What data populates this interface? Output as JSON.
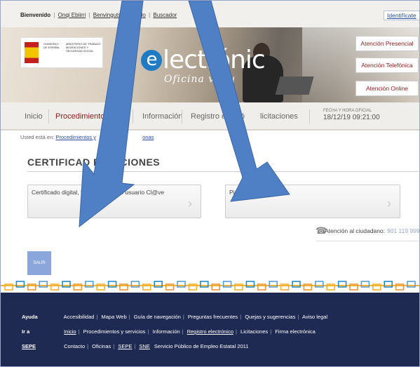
{
  "topbar": {
    "welcome": "Bienvenido",
    "user": "Onqi Ebiirri",
    "links": [
      "Benvinguts",
      "Benido",
      "Buscador"
    ],
    "identify": "Identifícate"
  },
  "banner": {
    "brand_text": "lectrónic",
    "brand_letter": "e",
    "subtitle": "Oficina virtu",
    "gov_logo_left": "GOBIERNO DE ESPAÑA",
    "gov_logo_right": "MINISTERIO DE TRABAJO MIGRACIONES Y SEGURIDAD SOCIAL",
    "buttons": [
      "Atención Presencial",
      "Atención Telefónica",
      "Atención Online"
    ]
  },
  "nav": {
    "tabs": [
      "Inicio",
      "Procedimientos",
      "Información",
      "Registro electró",
      "licitaciones"
    ],
    "date_label": "FECHA Y HORA OFICIAL",
    "date_value": "18/12/19   09:21:00"
  },
  "breadcrumb": {
    "prefix": "Usted está en:",
    "link": "Procedimientos y",
    "tail": "onas"
  },
  "main": {
    "title": "CERTIFICAD          ESTACIONES",
    "cards": [
      {
        "label": "Certificado digital, DNI e         ctrónico o usuario Cl@ve"
      },
      {
        "label": "Pin Teléfono Mó"
      }
    ],
    "support_label": "Atención al ciudadano:",
    "support_phone": "901 119 999",
    "exit_label": "SALIR"
  },
  "footer": {
    "rows": [
      {
        "key": "Ayuda",
        "items": [
          "Accesibilidad",
          "Mapa Web",
          "Guía de navegación",
          "Preguntas frecuentes",
          "Quejas y sugerencias",
          "Aviso legal"
        ]
      },
      {
        "key": "Ir a",
        "items": [
          "Inicio",
          "Procedimientos y servicios",
          "Información",
          "Registro electrónico",
          "Licitaciones",
          "Firma electrónica"
        ]
      },
      {
        "key": "SEPE",
        "items": [
          "Contacto",
          "Oficinas",
          "SEPE",
          "SNE",
          "Servicio Público de Empleo Estatal 2011"
        ]
      }
    ]
  },
  "colors": {
    "accent_red": "#8a1c1c",
    "footer_bg": "#1f2a52",
    "arrow_blue": "#4f7fc4",
    "exit_button": "#8aa6db"
  }
}
